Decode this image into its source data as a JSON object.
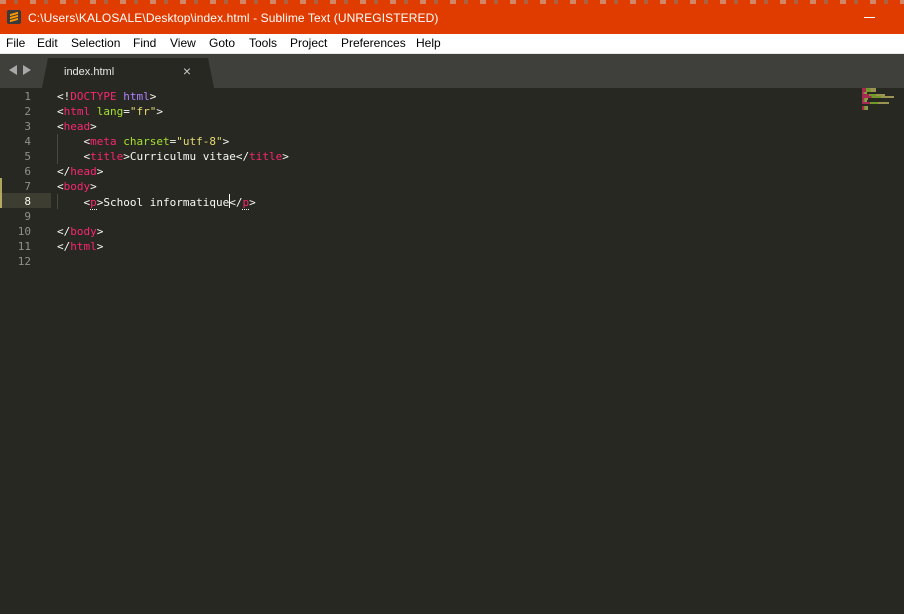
{
  "window": {
    "title": "C:\\Users\\KALOSALE\\Desktop\\index.html - Sublime Text (UNREGISTERED)",
    "minimize_icon": "minimize-icon",
    "app_icon": "sublime-text-icon"
  },
  "menu": [
    "File",
    "Edit",
    "Selection",
    "Find",
    "View",
    "Goto",
    "Tools",
    "Project",
    "Preferences",
    "Help"
  ],
  "tabs": [
    {
      "label": "index.html",
      "close_glyph": "×",
      "active": true
    }
  ],
  "editor": {
    "active_line": 8,
    "lines": [
      {
        "n": "1",
        "tokens": [
          [
            "p",
            "<!"
          ],
          [
            "tag",
            "DOCTYPE"
          ],
          [
            "p",
            " "
          ],
          [
            "kw",
            "html"
          ],
          [
            "p",
            ">"
          ]
        ]
      },
      {
        "n": "2",
        "tokens": [
          [
            "p",
            "<"
          ],
          [
            "tag",
            "html"
          ],
          [
            "p",
            " "
          ],
          [
            "attr",
            "lang"
          ],
          [
            "p",
            "="
          ],
          [
            "str",
            "\"fr\""
          ],
          [
            "p",
            ">"
          ]
        ]
      },
      {
        "n": "3",
        "tokens": [
          [
            "p",
            "<"
          ],
          [
            "tag",
            "head"
          ],
          [
            "p",
            ">"
          ]
        ]
      },
      {
        "n": "4",
        "tokens": [
          [
            "p",
            "    <"
          ],
          [
            "tag",
            "meta"
          ],
          [
            "p",
            " "
          ],
          [
            "attr",
            "charset"
          ],
          [
            "p",
            "="
          ],
          [
            "str",
            "\"utf-8\""
          ],
          [
            "p",
            ">"
          ]
        ]
      },
      {
        "n": "5",
        "tokens": [
          [
            "p",
            "    <"
          ],
          [
            "tag",
            "title"
          ],
          [
            "p",
            ">Curriculmu vitae</"
          ],
          [
            "tag",
            "title"
          ],
          [
            "p",
            ">"
          ]
        ]
      },
      {
        "n": "6",
        "tokens": [
          [
            "p",
            "</"
          ],
          [
            "tag",
            "head"
          ],
          [
            "p",
            ">"
          ]
        ]
      },
      {
        "n": "7",
        "tokens": [
          [
            "p",
            "<"
          ],
          [
            "tag",
            "body"
          ],
          [
            "p",
            ">"
          ]
        ]
      },
      {
        "n": "8",
        "tokens": [
          [
            "p",
            "    <"
          ],
          [
            "tagu",
            "p"
          ],
          [
            "p",
            ">School informatique"
          ],
          [
            "cursor",
            ""
          ],
          [
            "p",
            "</"
          ],
          [
            "tagu",
            "p"
          ],
          [
            "p",
            ">"
          ]
        ]
      },
      {
        "n": "9",
        "tokens": []
      },
      {
        "n": "10",
        "tokens": [
          [
            "p",
            "</"
          ],
          [
            "tag",
            "body"
          ],
          [
            "p",
            ">"
          ]
        ]
      },
      {
        "n": "11",
        "tokens": [
          [
            "p",
            "</"
          ],
          [
            "tag",
            "html"
          ],
          [
            "p",
            ">"
          ]
        ]
      },
      {
        "n": "12",
        "tokens": []
      }
    ]
  },
  "colors": {
    "titlebar": "#e03c00",
    "editor_bg": "#272822",
    "tag": "#f92672",
    "attr": "#a6e22e",
    "string": "#e6db74",
    "keyword": "#ae81ff"
  }
}
